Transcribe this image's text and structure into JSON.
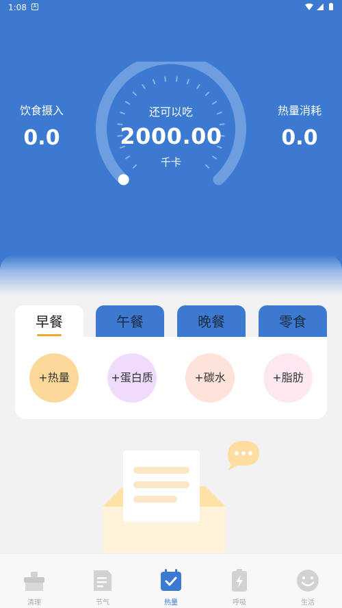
{
  "status_bar": {
    "time": "1:08",
    "notif_glyph": "A"
  },
  "header": {
    "intake": {
      "label": "饮食摄入",
      "value": "0.0"
    },
    "remaining": {
      "label": "还可以吃",
      "value": "2000.00",
      "unit": "千卡"
    },
    "burned": {
      "label": "热量消耗",
      "value": "0.0"
    },
    "gauge_progress": 0.0
  },
  "meals": {
    "tabs": [
      {
        "label": "早餐",
        "active": true
      },
      {
        "label": "午餐",
        "active": false
      },
      {
        "label": "晚餐",
        "active": false
      },
      {
        "label": "零食",
        "active": false
      }
    ],
    "nutrients": [
      {
        "label": "+热量",
        "color": "#fcd99a"
      },
      {
        "label": "+蛋白质",
        "color": "#efdcfb"
      },
      {
        "label": "+碳水",
        "color": "#fde3d9"
      },
      {
        "label": "+脂肪",
        "color": "#fde8f1"
      }
    ]
  },
  "bottom_nav": [
    {
      "label": "清理",
      "icon": "broom-icon",
      "active": false
    },
    {
      "label": "节气",
      "icon": "document-icon",
      "active": false
    },
    {
      "label": "热量",
      "icon": "calendar-check-icon",
      "active": true
    },
    {
      "label": "呼吸",
      "icon": "battery-bolt-icon",
      "active": false
    },
    {
      "label": "生活",
      "icon": "smile-icon",
      "active": false
    }
  ],
  "colors": {
    "primary": "#3b7ad0",
    "accent": "#f5a623",
    "background": "#f2f2f4"
  }
}
